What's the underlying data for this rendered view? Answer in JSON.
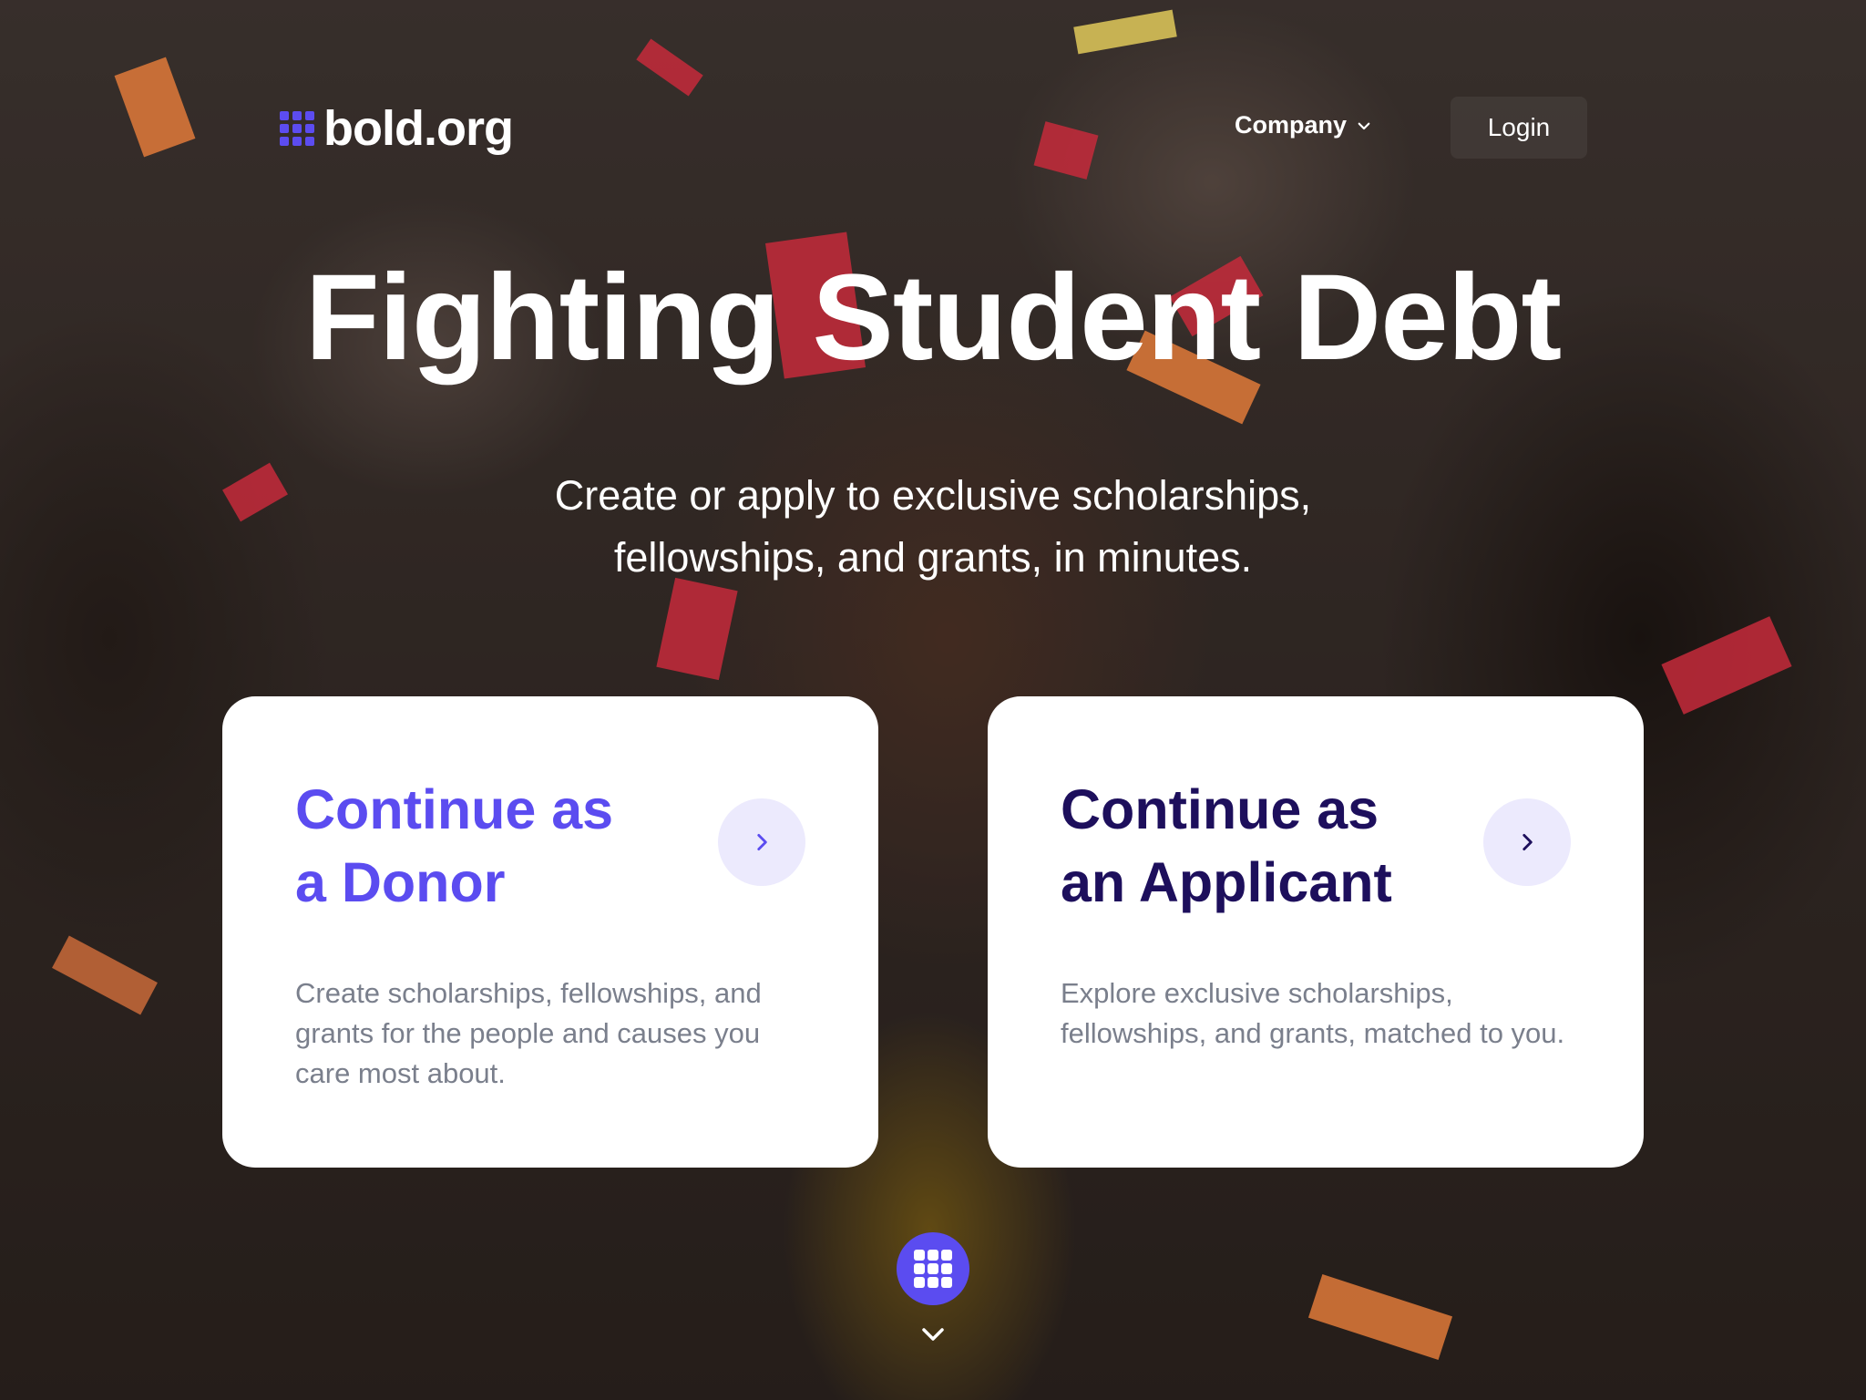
{
  "brand": {
    "name": "bold.org",
    "accent_color": "#5b4cf0",
    "dark_color": "#1d0f5c"
  },
  "header": {
    "menu_label": "Company",
    "menu_icon": "chevron-down-icon",
    "login_label": "Login"
  },
  "hero": {
    "headline": "Fighting Student Debt",
    "subheadline_line1": "Create or apply to exclusive scholarships,",
    "subheadline_line2": "fellowships, and grants, in minutes."
  },
  "cards": [
    {
      "title_line1": "Continue as",
      "title_line2": "a Donor",
      "description": "Create scholarships, fellowships, and grants for the people and causes you care most about.",
      "icon": "chevron-right-icon"
    },
    {
      "title_line1": "Continue as",
      "title_line2": "an Applicant",
      "description": "Explore exclusive scholarships, fellowships, and grants, matched to you.",
      "icon": "chevron-right-icon"
    }
  ],
  "scroll": {
    "button_icon": "grid-icon",
    "indicator_icon": "chevron-down-icon"
  }
}
